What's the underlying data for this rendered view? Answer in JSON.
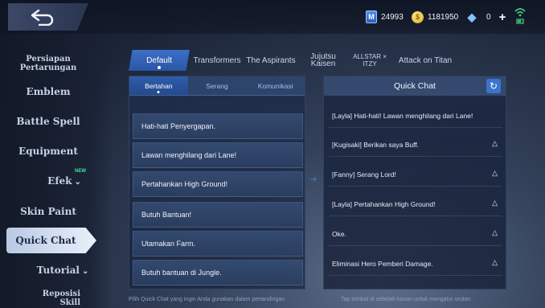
{
  "topbar": {
    "currencies": [
      {
        "icon": "diamond-ticket-icon",
        "value": "24993"
      },
      {
        "icon": "gold-coin-icon",
        "value": "1181950"
      },
      {
        "icon": "gem-icon",
        "value": "0"
      }
    ],
    "add_label": "+"
  },
  "sidebar": {
    "items": [
      {
        "label": "Persiapan Pertarungan"
      },
      {
        "label": "Emblem"
      },
      {
        "label": "Battle Spell"
      },
      {
        "label": "Equipment"
      },
      {
        "label": "Efek",
        "badge": "NEW"
      },
      {
        "label": "Skin Paint"
      },
      {
        "label": "Quick Chat"
      },
      {
        "label": "Tutorial"
      },
      {
        "label": "Reposisi Skill"
      }
    ]
  },
  "tabs": [
    "Default",
    "Transformers",
    "The Aspirants",
    "Jujutsu Kaisen",
    "ALLSTAR × ITZY",
    "Attack on Titan"
  ],
  "subtabs": [
    "Bertahan",
    "Serang",
    "Komunikasi"
  ],
  "phrases": [
    "Hati-hati Penyergapan.",
    "Lawan menghilang dari Lane!",
    "Pertahankan High Ground!",
    "Butuh Bantuan!",
    "Utamakan Farm.",
    "Butuh bantuan di Jungle."
  ],
  "quick_chat": {
    "title": "Quick Chat",
    "items": [
      "[Layla] Hati-hati! Lawan menghilang dari Lane!",
      "[Kugisaki] Berikan saya Buff.",
      "[Fanny] Serang Lord!",
      "[Layla] Pertahankan High Ground!",
      "Oke.",
      "Eliminasi Hero Pemberi Damage."
    ]
  },
  "hints": {
    "left": "Pilih Quick Chat yang ingin Anda gunakan dalam pertandingan",
    "right": "Tap tombol di sebelah kanan untuk mengatur urutan"
  },
  "colors": {
    "accent": "#3c74cc",
    "active_tab": "#2a56a6",
    "side_active": "#e9f0fb"
  }
}
